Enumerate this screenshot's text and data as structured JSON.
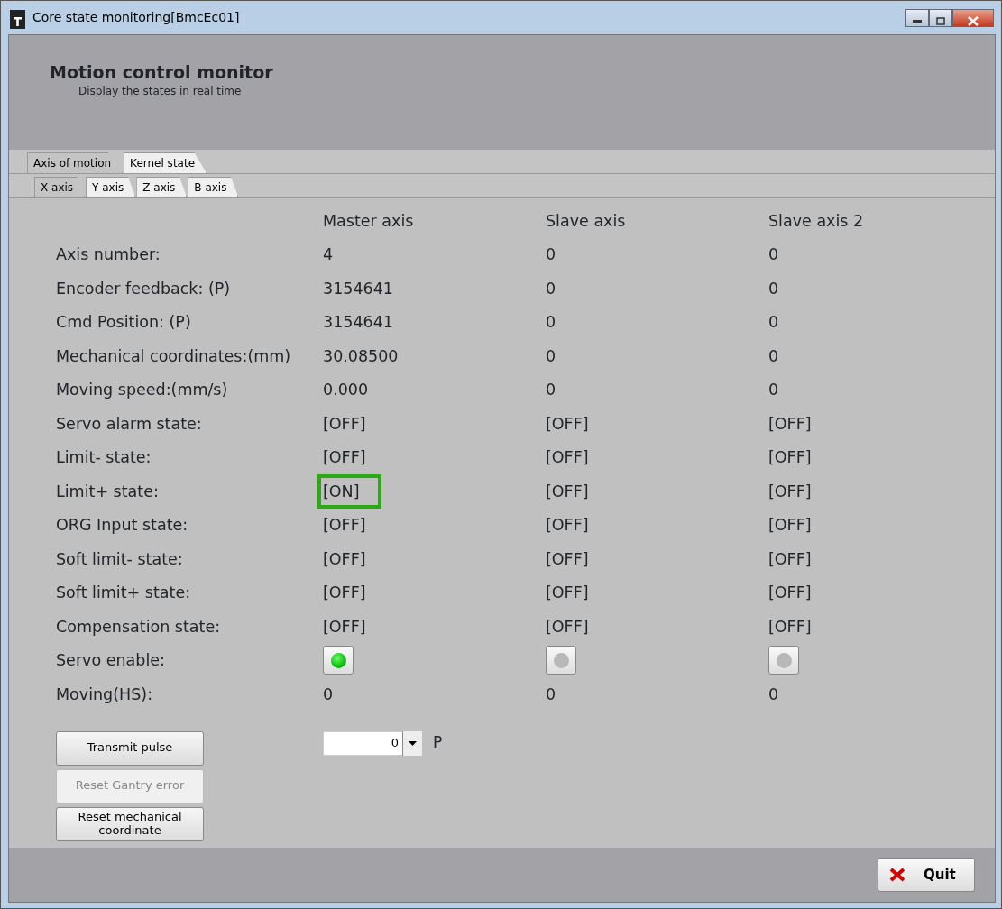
{
  "window": {
    "title": "Core state monitoring[BmcEc01]"
  },
  "header": {
    "title": "Motion control monitor",
    "subtitle": "Display the states in real time"
  },
  "tabs": [
    {
      "label": "Axis of motion",
      "selected": true
    },
    {
      "label": "Kernel state",
      "selected": false
    }
  ],
  "sub_tabs": [
    {
      "label": "X axis",
      "selected": true
    },
    {
      "label": "Y axis",
      "selected": false
    },
    {
      "label": "Z axis",
      "selected": false
    },
    {
      "label": "B axis",
      "selected": false
    }
  ],
  "columns": [
    "Master axis",
    "Slave axis",
    "Slave axis 2"
  ],
  "rows": [
    {
      "label": "Axis number:",
      "kind": "text",
      "values": [
        {
          "text": "4",
          "highlighted": false
        },
        {
          "text": "0",
          "highlighted": false
        },
        {
          "text": "0",
          "highlighted": false
        }
      ]
    },
    {
      "label": "Encoder feedback: (P)",
      "kind": "text",
      "values": [
        {
          "text": "3154641",
          "highlighted": false
        },
        {
          "text": "0",
          "highlighted": false
        },
        {
          "text": "0",
          "highlighted": false
        }
      ]
    },
    {
      "label": "Cmd Position: (P)",
      "kind": "text",
      "values": [
        {
          "text": "3154641",
          "highlighted": false
        },
        {
          "text": "0",
          "highlighted": false
        },
        {
          "text": "0",
          "highlighted": false
        }
      ]
    },
    {
      "label": "Mechanical coordinates:(mm)",
      "kind": "text",
      "values": [
        {
          "text": "30.08500",
          "highlighted": false
        },
        {
          "text": "0",
          "highlighted": false
        },
        {
          "text": "0",
          "highlighted": false
        }
      ]
    },
    {
      "label": "Moving speed:(mm/s)",
      "kind": "text",
      "values": [
        {
          "text": "0.000",
          "highlighted": false
        },
        {
          "text": "0",
          "highlighted": false
        },
        {
          "text": "0",
          "highlighted": false
        }
      ]
    },
    {
      "label": "Servo alarm state:",
      "kind": "text",
      "values": [
        {
          "text": "[OFF]",
          "highlighted": false
        },
        {
          "text": "[OFF]",
          "highlighted": false
        },
        {
          "text": "[OFF]",
          "highlighted": false
        }
      ]
    },
    {
      "label": "Limit- state:",
      "kind": "text",
      "values": [
        {
          "text": "[OFF]",
          "highlighted": false
        },
        {
          "text": "[OFF]",
          "highlighted": false
        },
        {
          "text": "[OFF]",
          "highlighted": false
        }
      ]
    },
    {
      "label": "Limit+ state:",
      "kind": "text",
      "values": [
        {
          "text": "[ON]",
          "highlighted": true
        },
        {
          "text": "[OFF]",
          "highlighted": false
        },
        {
          "text": "[OFF]",
          "highlighted": false
        }
      ]
    },
    {
      "label": "ORG Input state:",
      "kind": "text",
      "values": [
        {
          "text": "[OFF]",
          "highlighted": false
        },
        {
          "text": "[OFF]",
          "highlighted": false
        },
        {
          "text": "[OFF]",
          "highlighted": false
        }
      ]
    },
    {
      "label": "Soft limit- state:",
      "kind": "text",
      "values": [
        {
          "text": "[OFF]",
          "highlighted": false
        },
        {
          "text": "[OFF]",
          "highlighted": false
        },
        {
          "text": "[OFF]",
          "highlighted": false
        }
      ]
    },
    {
      "label": "Soft limit+ state:",
      "kind": "text",
      "values": [
        {
          "text": "[OFF]",
          "highlighted": false
        },
        {
          "text": "[OFF]",
          "highlighted": false
        },
        {
          "text": "[OFF]",
          "highlighted": false
        }
      ]
    },
    {
      "label": "Compensation state:",
      "kind": "text",
      "values": [
        {
          "text": "[OFF]",
          "highlighted": false
        },
        {
          "text": "[OFF]",
          "highlighted": false
        },
        {
          "text": "[OFF]",
          "highlighted": false
        }
      ]
    },
    {
      "label": "Servo enable:",
      "kind": "led",
      "values": [
        {
          "on": true
        },
        {
          "on": false
        },
        {
          "on": false
        }
      ]
    },
    {
      "label": "Moving(HS):",
      "kind": "text",
      "values": [
        {
          "text": "0",
          "highlighted": false
        },
        {
          "text": "0",
          "highlighted": false
        },
        {
          "text": "0",
          "highlighted": false
        }
      ]
    }
  ],
  "actions": [
    {
      "label": "Transmit pulse",
      "disabled": false
    },
    {
      "label": "Reset Gantry error",
      "disabled": true
    },
    {
      "label": "Reset mechanical coordinate",
      "disabled": false
    }
  ],
  "pulse": {
    "value": "0",
    "unit": "P"
  },
  "footer": {
    "quit": "Quit"
  }
}
